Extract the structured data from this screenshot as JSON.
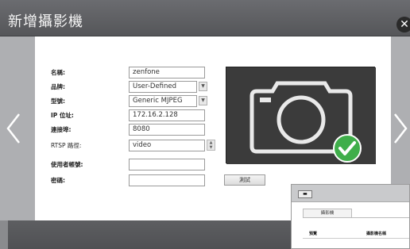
{
  "dialog": {
    "title": "新增攝影機",
    "close_label": "⊗"
  },
  "nav": {
    "prev_label": "‹",
    "next_label": "›"
  },
  "form": {
    "fields": [
      {
        "label": "名稱:",
        "value": "zenfone",
        "type": "text"
      },
      {
        "label": "品牌:",
        "value": "User-Defined",
        "type": "select"
      },
      {
        "label": "型號:",
        "value": "Generic MJPEG",
        "type": "select"
      },
      {
        "label": "IP 位址:",
        "value": "172.16.2.128",
        "type": "text"
      },
      {
        "label": "連接埠:",
        "value": "8080",
        "type": "text"
      },
      {
        "label": "RTSP 路徑:",
        "value": "video",
        "type": "text"
      },
      {
        "label": "使用者帳號:",
        "value": "",
        "type": "text"
      },
      {
        "label": "密碼:",
        "value": "",
        "type": "password"
      }
    ],
    "test_button": "測試"
  },
  "camera_preview": {
    "icon": "camera-icon",
    "status_icon": "check-circle-icon",
    "status_color": "#3fae4a"
  },
  "thumbnail_window": {
    "tab_label": "攝影機",
    "col1": "預覽",
    "col2": "攝影機名稱"
  }
}
